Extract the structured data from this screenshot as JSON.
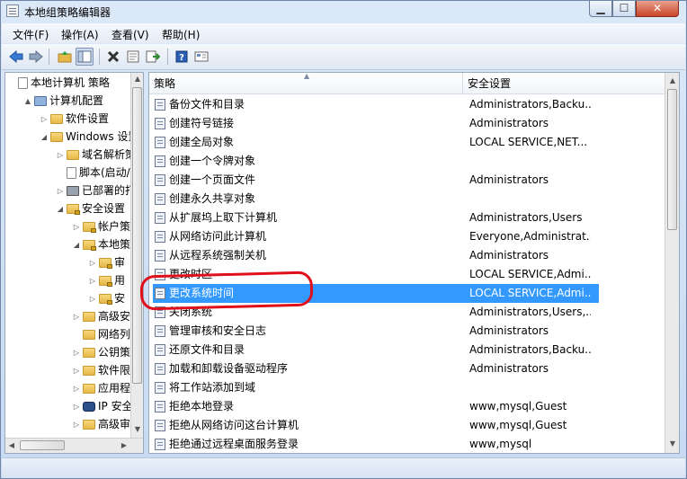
{
  "window": {
    "title": "本地组策略编辑器"
  },
  "menu": [
    "文件(F)",
    "操作(A)",
    "查看(V)",
    "帮助(H)"
  ],
  "toolbar": [
    "back-arrow-icon",
    "forward-arrow-icon",
    "up-folder-icon",
    "show-hide-tree-icon",
    "delete-icon",
    "properties-icon",
    "export-list-icon",
    "help-icon",
    "view-icon"
  ],
  "tree": [
    {
      "label": "本地计算机 策略",
      "icon": "doc",
      "indent": 0,
      "arrow": ""
    },
    {
      "label": "计算机配置",
      "icon": "pc",
      "indent": 1,
      "arrow": "▲"
    },
    {
      "label": "软件设置",
      "icon": "folder",
      "indent": 2,
      "arrow": "▷"
    },
    {
      "label": "Windows 设置",
      "icon": "folder",
      "indent": 2,
      "arrow": "◢"
    },
    {
      "label": "域名解析策",
      "icon": "folder",
      "indent": 3,
      "arrow": "▷"
    },
    {
      "label": "脚本(启动/",
      "icon": "doc",
      "indent": 3,
      "arrow": ""
    },
    {
      "label": "已部署的打",
      "icon": "printer",
      "indent": 3,
      "arrow": "▷"
    },
    {
      "label": "安全设置",
      "icon": "lockf",
      "indent": 3,
      "arrow": "◢"
    },
    {
      "label": "帐户策",
      "icon": "lockf",
      "indent": 4,
      "arrow": "▷"
    },
    {
      "label": "本地策",
      "icon": "lockf",
      "indent": 4,
      "arrow": "◢"
    },
    {
      "label": "审",
      "icon": "lockf",
      "indent": 5,
      "arrow": "▷"
    },
    {
      "label": "用",
      "icon": "lockf",
      "indent": 5,
      "arrow": "▷"
    },
    {
      "label": "安",
      "icon": "lockf",
      "indent": 5,
      "arrow": "▷"
    },
    {
      "label": "高级安",
      "icon": "folder",
      "indent": 4,
      "arrow": "▷"
    },
    {
      "label": "网络列",
      "icon": "folder",
      "indent": 4,
      "arrow": ""
    },
    {
      "label": "公钥策",
      "icon": "folder",
      "indent": 4,
      "arrow": "▷"
    },
    {
      "label": "软件限",
      "icon": "folder",
      "indent": 4,
      "arrow": "▷"
    },
    {
      "label": "应用程",
      "icon": "folder",
      "indent": 4,
      "arrow": "▷"
    },
    {
      "label": "IP 安全",
      "icon": "net",
      "indent": 4,
      "arrow": "▷"
    },
    {
      "label": "高级审",
      "icon": "folder",
      "indent": 4,
      "arrow": "▷"
    }
  ],
  "columns": {
    "policy": "策略",
    "setting": "安全设置"
  },
  "policies": [
    {
      "name": "备份文件和目录",
      "setting": "Administrators,Backu..."
    },
    {
      "name": "创建符号链接",
      "setting": "Administrators"
    },
    {
      "name": "创建全局对象",
      "setting": "LOCAL SERVICE,NET..."
    },
    {
      "name": "创建一个令牌对象",
      "setting": ""
    },
    {
      "name": "创建一个页面文件",
      "setting": "Administrators"
    },
    {
      "name": "创建永久共享对象",
      "setting": ""
    },
    {
      "name": "从扩展坞上取下计算机",
      "setting": "Administrators,Users"
    },
    {
      "name": "从网络访问此计算机",
      "setting": "Everyone,Administrat..."
    },
    {
      "name": "从远程系统强制关机",
      "setting": "Administrators"
    },
    {
      "name": "更改时区",
      "setting": "LOCAL SERVICE,Admi..."
    },
    {
      "name": "更改系统时间",
      "setting": "LOCAL SERVICE,Admi...",
      "selected": true
    },
    {
      "name": "关闭系统",
      "setting": "Administrators,Users,..."
    },
    {
      "name": "管理审核和安全日志",
      "setting": "Administrators"
    },
    {
      "name": "还原文件和目录",
      "setting": "Administrators,Backu..."
    },
    {
      "name": "加载和卸载设备驱动程序",
      "setting": "Administrators"
    },
    {
      "name": "将工作站添加到域",
      "setting": ""
    },
    {
      "name": "拒绝本地登录",
      "setting": "www,mysql,Guest"
    },
    {
      "name": "拒绝从网络访问这台计算机",
      "setting": "www,mysql,Guest"
    },
    {
      "name": "拒绝通过远程桌面服务登录",
      "setting": "www,mysql"
    }
  ],
  "colors": {
    "selection": "#3399ff",
    "annotation": "#e0101a"
  }
}
